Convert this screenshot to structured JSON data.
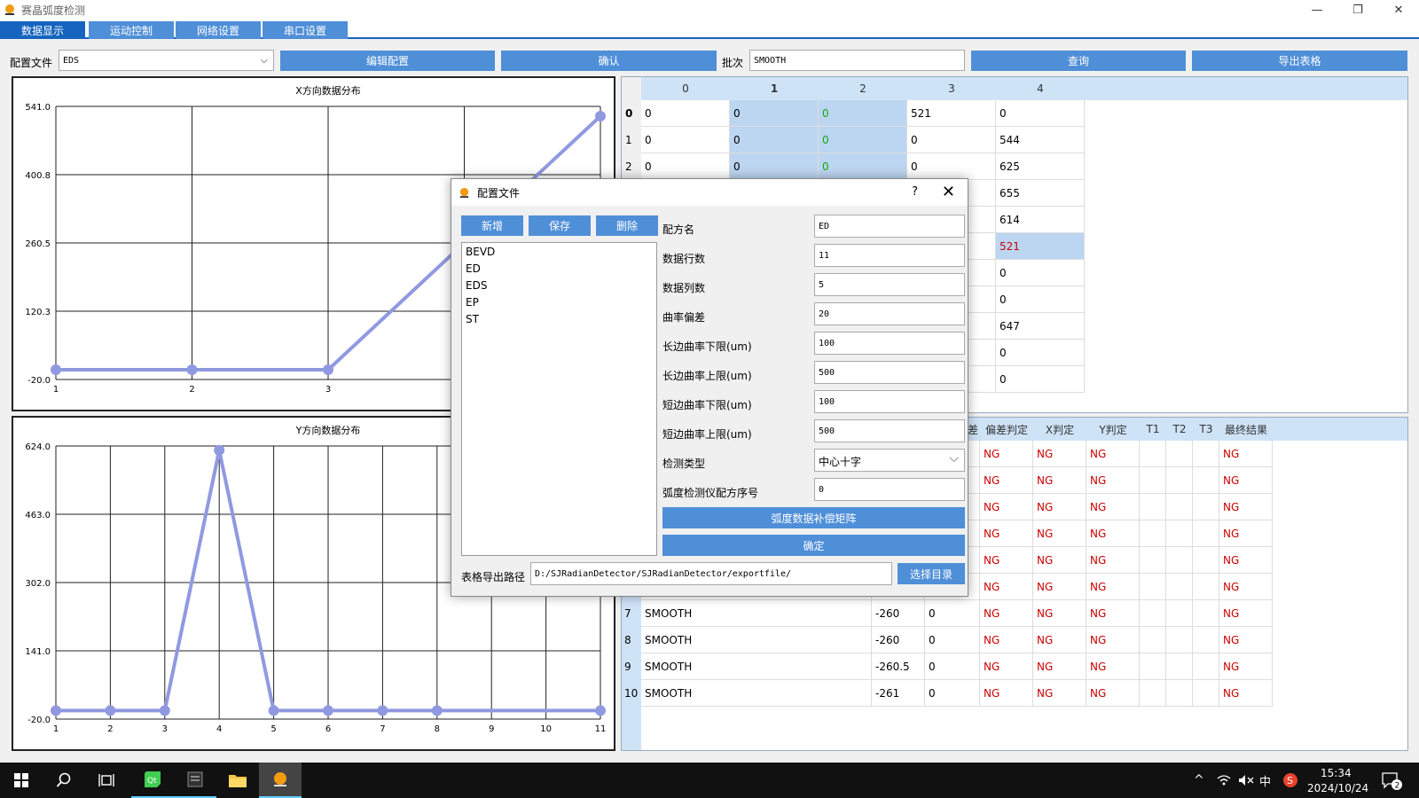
{
  "window": {
    "title": "赛晶弧度检测",
    "controls": [
      "—",
      "❐",
      "✕"
    ]
  },
  "tabs": [
    {
      "label": "数据显示",
      "active": true
    },
    {
      "label": "运动控制"
    },
    {
      "label": "网络设置"
    },
    {
      "label": "串口设置"
    }
  ],
  "toolbar": {
    "config_label": "配置文件",
    "config_value": "EDS",
    "edit_btn": "编辑配置",
    "confirm_btn": "确认",
    "batch_label": "批次",
    "batch_value": "SMOOTH",
    "query_btn": "查询",
    "export_btn": "导出表格"
  },
  "charts": [
    {
      "title": "X方向数据分布",
      "yticks": [
        "541.0",
        "400.8",
        "260.5",
        "120.3",
        "-20.0"
      ],
      "ylim": [
        -20,
        541
      ],
      "xticks": [
        "1",
        "2",
        "3"
      ],
      "x": [
        1,
        2,
        3,
        11
      ],
      "y": [
        0,
        0,
        0,
        521
      ],
      "xlim": [
        1,
        11
      ],
      "color": "#9099e0"
    },
    {
      "title": "Y方向数据分布",
      "yticks": [
        "624.0",
        "463.0",
        "302.0",
        "141.0",
        "-20.0"
      ],
      "ylim": [
        -20,
        624
      ],
      "xticks": [
        "1",
        "2",
        "3",
        "4",
        "5",
        "6",
        "7",
        "8",
        "9",
        "10",
        "11"
      ],
      "x": [
        1,
        2,
        3,
        4,
        5,
        6,
        7,
        8,
        11
      ],
      "y": [
        0,
        0,
        0,
        614,
        0,
        0,
        0,
        0,
        0
      ],
      "xlim": [
        1,
        11
      ],
      "color": "#9099e0"
    }
  ],
  "top_table": {
    "columns": [
      "0",
      "1",
      "2",
      "3",
      "4"
    ],
    "rows": [
      {
        "idx": "0",
        "cells": [
          "0",
          "0",
          "0",
          "521",
          "0"
        ]
      },
      {
        "idx": "1",
        "cells": [
          "0",
          "0",
          "0",
          "0",
          "544"
        ]
      },
      {
        "idx": "2",
        "cells": [
          "0",
          "0",
          "0",
          "0",
          "625"
        ]
      },
      {
        "idx": "",
        "cells": [
          "",
          "",
          "",
          "",
          "655"
        ]
      },
      {
        "idx": "",
        "cells": [
          "",
          "",
          "",
          "",
          "614"
        ]
      },
      {
        "idx": "",
        "cells": [
          "",
          "",
          "",
          "",
          "521"
        ]
      },
      {
        "idx": "",
        "cells": [
          "",
          "",
          "",
          "",
          "0"
        ]
      },
      {
        "idx": "",
        "cells": [
          "",
          "",
          "",
          "",
          "0"
        ]
      },
      {
        "idx": "",
        "cells": [
          "",
          "",
          "",
          "",
          "647"
        ]
      },
      {
        "idx": "",
        "cells": [
          "",
          "",
          "",
          "",
          "0"
        ]
      },
      {
        "idx": "",
        "cells": [
          "",
          "",
          "",
          "",
          "0"
        ]
      }
    ]
  },
  "bottom_table": {
    "columns": [
      "",
      "",
      "",
      "",
      "偏差判定",
      "X判定",
      "Y判定",
      "T1",
      "T2",
      "T3",
      "最终结果"
    ],
    "partial_header": "差",
    "rows": [
      {
        "idx": "",
        "batch": "",
        "a": "",
        "b": "",
        "dev": "NG",
        "x": "NG",
        "y": "NG",
        "final": "NG"
      },
      {
        "idx": "",
        "batch": "",
        "a": "",
        "b": "",
        "dev": "NG",
        "x": "NG",
        "y": "NG",
        "final": "NG"
      },
      {
        "idx": "",
        "batch": "",
        "a": "",
        "b": "",
        "dev": "NG",
        "x": "NG",
        "y": "NG",
        "final": "NG"
      },
      {
        "idx": "",
        "batch": "",
        "a": "",
        "b": "",
        "dev": "NG",
        "x": "NG",
        "y": "NG",
        "final": "NG"
      },
      {
        "idx": "",
        "batch": "",
        "a": "",
        "b": "",
        "dev": "NG",
        "x": "NG",
        "y": "NG",
        "final": "NG"
      },
      {
        "idx": "",
        "batch": "",
        "a": "",
        "b": "",
        "dev": "NG",
        "x": "NG",
        "y": "NG",
        "final": "NG"
      },
      {
        "idx": "7",
        "batch": "SMOOTH",
        "a": "-260",
        "b": "0",
        "dev": "NG",
        "x": "NG",
        "y": "NG",
        "final": "NG"
      },
      {
        "idx": "8",
        "batch": "SMOOTH",
        "a": "-260",
        "b": "0",
        "dev": "NG",
        "x": "NG",
        "y": "NG",
        "final": "NG"
      },
      {
        "idx": "9",
        "batch": "SMOOTH",
        "a": "-260.5",
        "b": "0",
        "dev": "NG",
        "x": "NG",
        "y": "NG",
        "final": "NG"
      },
      {
        "idx": "10",
        "batch": "SMOOTH",
        "a": "-261",
        "b": "0",
        "dev": "NG",
        "x": "NG",
        "y": "NG",
        "final": "NG"
      }
    ]
  },
  "dialog": {
    "title": "配置文件",
    "help": "?",
    "close": "✕",
    "btn_new": "新增",
    "btn_save": "保存",
    "btn_delete": "删除",
    "list": [
      "BEVD",
      "ED",
      "EDS",
      "EP",
      "ST"
    ],
    "fields": [
      {
        "label": "配方名",
        "value": "ED"
      },
      {
        "label": "数据行数",
        "value": "11"
      },
      {
        "label": "数据列数",
        "value": "5"
      },
      {
        "label": "曲率偏差",
        "value": "20"
      },
      {
        "label": "长边曲率下限(um)",
        "value": "100"
      },
      {
        "label": "长边曲率上限(um)",
        "value": "500"
      },
      {
        "label": "短边曲率下限(um)",
        "value": "100"
      },
      {
        "label": "短边曲率上限(um)",
        "value": "500"
      },
      {
        "label": "检测类型",
        "value": "中心十字"
      },
      {
        "label": "弧度检测仪配方序号",
        "value": "0"
      }
    ],
    "btn_matrix": "弧度数据补偿矩阵",
    "btn_ok": "确定",
    "path_label": "表格导出路径",
    "path_value": "D:/SJRadianDetector/SJRadianDetector/exportfile/",
    "btn_choose": "选择目录"
  },
  "taskbar": {
    "time": "15:34",
    "date": "2024/10/24",
    "ime": "中",
    "notif": "2"
  }
}
